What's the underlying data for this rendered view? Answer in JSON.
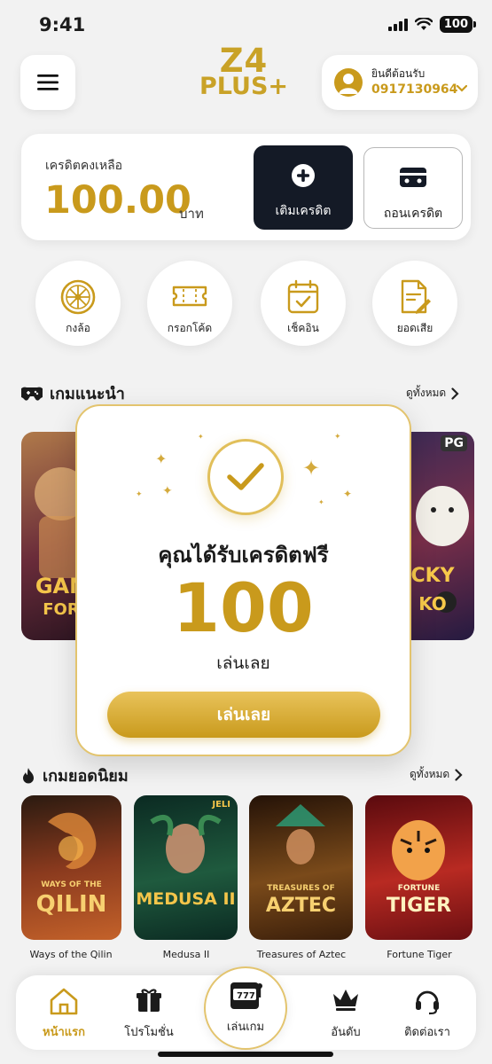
{
  "status": {
    "time": "9:41",
    "battery": "100"
  },
  "header": {
    "logo_line1": "Z4",
    "logo_line2": "PLUS+",
    "welcome": "ยินดีต้อนรับ",
    "phone": "0917130964"
  },
  "credit": {
    "label": "เครดิตคงเหลือ",
    "amount": "100.00",
    "unit": "บาท",
    "deposit_label": "เติมเครดิต",
    "withdraw_label": "ถอนเครดิต"
  },
  "quick_actions": [
    {
      "label": "กงล้อ",
      "icon": "wheel-icon"
    },
    {
      "label": "กรอกโค้ด",
      "icon": "ticket-icon"
    },
    {
      "label": "เช็คอิน",
      "icon": "calendar-check-icon"
    },
    {
      "label": "ยอดเสีย",
      "icon": "document-edit-icon"
    }
  ],
  "recommended": {
    "title": "เกมแนะนำ",
    "see_all": "ดูทั้งหมด",
    "left_card_text1": "GAN",
    "left_card_text2": "FOR",
    "right_card_badge": "PG",
    "right_card_text1": "CKY",
    "right_card_text2": "KO"
  },
  "modal": {
    "title": "คุณได้รับเครดิตฟรี",
    "amount": "100",
    "subtitle": "เล่นเลย",
    "button": "เล่นเลย"
  },
  "popular": {
    "title": "เกมยอดนิยม",
    "see_all": "ดูทั้งหมด",
    "games": [
      {
        "name": "Ways of the Qilin",
        "art_text": "QILIN",
        "art_small": "WAYS OF THE",
        "colors": [
          "#4a1d12",
          "#c4622a"
        ]
      },
      {
        "name": "Medusa II",
        "art_text": "MEDUSA II",
        "art_small": "JELI",
        "colors": [
          "#0f3a2c",
          "#2f7a52"
        ]
      },
      {
        "name": "Treasures of Aztec",
        "art_text": "AZTEC",
        "art_small": "TREASURES OF",
        "colors": [
          "#3a1e0a",
          "#a8641f"
        ]
      },
      {
        "name": "Fortune Tiger",
        "art_text": "TIGER",
        "art_small": "FORTUNE",
        "colors": [
          "#6b0f12",
          "#d23a2a"
        ]
      }
    ]
  },
  "nav": {
    "items": [
      {
        "label": "หน้าแรก",
        "icon": "home-icon",
        "active": true
      },
      {
        "label": "โปรโมชั่น",
        "icon": "gift-icon"
      },
      {
        "label": "เล่นเกม",
        "icon": "slot-machine-icon"
      },
      {
        "label": "อันดับ",
        "icon": "crown-icon"
      },
      {
        "label": "ติดต่อเรา",
        "icon": "headset-icon"
      }
    ]
  },
  "colors": {
    "gold": "#c99a1c",
    "dark": "#141a26",
    "background": "#f2f2f2"
  }
}
